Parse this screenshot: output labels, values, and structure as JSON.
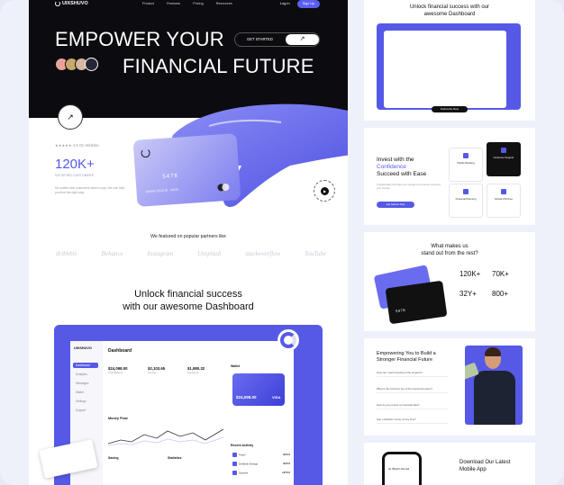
{
  "nav": {
    "logo": "UIXSHUVO",
    "links": [
      "Product",
      "Features",
      "Pricing",
      "Resources"
    ],
    "login": "Log In",
    "signup": "Sign Up"
  },
  "hero": {
    "line1": "EMPOWER YOUR",
    "line2": "FINANCIAL FUTURE",
    "cta": "GET STARTED",
    "cta_arrow": "↗",
    "card_number": "5478",
    "card_holder": "BIMAN SHOUR · 06/26"
  },
  "stats": {
    "rating_text": "★★★★★  4.8 On Website",
    "big_number": "120K+",
    "big_label": "SATISFIED CUSTOMERS",
    "description": "No matter how customers want to pay. We can help you find the right way."
  },
  "featured": {
    "title": "We featured on popular partners like",
    "partners": [
      "dribbble",
      "Behance",
      "Instagram",
      "Unsplash",
      "stackoverflow",
      "YouTube"
    ]
  },
  "dashboard_section": {
    "title_line1": "Unlock financial success",
    "title_line2": "with our awesome Dashboard",
    "app": {
      "logo": "UIXSHUVO",
      "heading": "Dashboard",
      "sidebar": [
        "Dashboard",
        "Analytics",
        "Messages",
        "Wallet",
        "Settings",
        "Support"
      ],
      "stats": [
        {
          "value": "$24,098.00",
          "label": "Total Balance"
        },
        {
          "value": "$2,103.65",
          "label": "Income"
        },
        {
          "value": "$1,980.32",
          "label": "Expenses"
        }
      ],
      "wallet_title": "Wallet",
      "card_amount": "$24,098.00",
      "card_brand": "VISA",
      "money_flow": "Money Flow",
      "recent_title": "Recent Activity",
      "recent": [
        {
          "name": "Fiverr",
          "amount": "-$20.0"
        },
        {
          "name": "Dribbble Design",
          "amount": "-$20.0"
        },
        {
          "name": "Upwork",
          "amount": "+$76.0"
        }
      ],
      "saving": "Saving",
      "statistics": "Statistics"
    }
  },
  "right": {
    "s1_title": "Unlock financial success with our awesome Dashboard",
    "subscribe": "Subscribe Now",
    "s2_title1": "Invest with the",
    "s2_title2": "Confidence",
    "s2_title3": "Succeed with Ease",
    "s2_desc": "A digital wallet that helps you manage your finances and grow your savings.",
    "s2_btn": "Get Started Now",
    "features": [
      "Mobile Banking",
      "Financial Planning",
      "Global ATM Fee",
      "Customer Support"
    ],
    "s3_title1": "What makes us",
    "s3_title2": "stand out from the rest?",
    "card_number": "5478",
    "s3_stats": [
      "120K+",
      "70K+",
      "32Y+",
      "800+"
    ],
    "s4_title1": "Empowering You to Build a",
    "s4_title2": "Stronger Financial Future",
    "faqs": [
      "How can I start investing in the program?",
      "What is the minimum fee of the investment plans?",
      "How do you protect my financial data?",
      "Can I withdraw money at any time?"
    ],
    "s5_title1": "Download Our Latest",
    "s5_title2": "Mobile App",
    "phone_text": "Hi, Boshir Ahmed"
  },
  "colors": {
    "accent": "#5659e6",
    "hero_bg": "#0c0c10"
  }
}
